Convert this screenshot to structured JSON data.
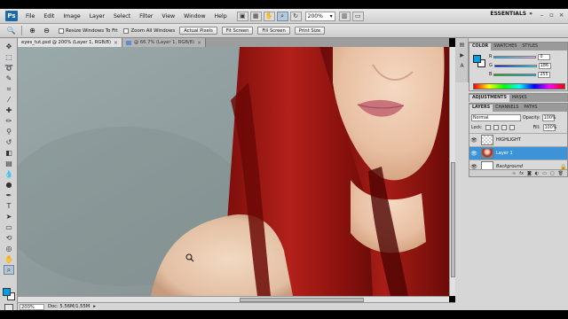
{
  "app": {
    "logo": "Ps"
  },
  "menu": [
    "File",
    "Edit",
    "Image",
    "Layer",
    "Select",
    "Filter",
    "View",
    "Window",
    "Help"
  ],
  "menu_zoom": "200%",
  "workspace": "ESSENTIALS",
  "options": {
    "resize_windows": "Resize Windows To Fit",
    "zoom_all": "Zoom All Windows",
    "actual_pixels": "Actual Pixels",
    "fit_screen": "Fit Screen",
    "fill_screen": "Fill Screen",
    "print_size": "Print Size"
  },
  "tabs": [
    {
      "label": "eyes_tut.psd @ 200% (Layer 1, RGB/8)"
    },
    {
      "label": "@ 66.7% (Layer 1, RGB/8)"
    }
  ],
  "status": {
    "zoom": "200%",
    "doc": "Doc: 5.56M/1.55M"
  },
  "color_panel": {
    "tabs": [
      "COLOR",
      "SWATCHES",
      "STYLES"
    ],
    "r": {
      "label": "R",
      "value": "0",
      "fraction": 0.0
    },
    "g": {
      "label": "G",
      "value": "186",
      "fraction": 0.73
    },
    "b": {
      "label": "B",
      "value": "255",
      "fraction": 1.0
    },
    "foreground": "#00A0E8",
    "background": "#FFFFFF"
  },
  "adj_panel": {
    "tabs": [
      "ADJUSTMENTS",
      "MASKS"
    ]
  },
  "layers_panel": {
    "tabs": [
      "LAYERS",
      "CHANNELS",
      "PATHS"
    ],
    "blend_mode": "Normal",
    "opacity_label": "Opacity:",
    "opacity": "100%",
    "lock_label": "Lock:",
    "fill_label": "Fill:",
    "fill": "100%",
    "layers": [
      {
        "name": "HIGHLIGHT"
      },
      {
        "name": "Layer 1"
      },
      {
        "name": "Background"
      }
    ]
  }
}
